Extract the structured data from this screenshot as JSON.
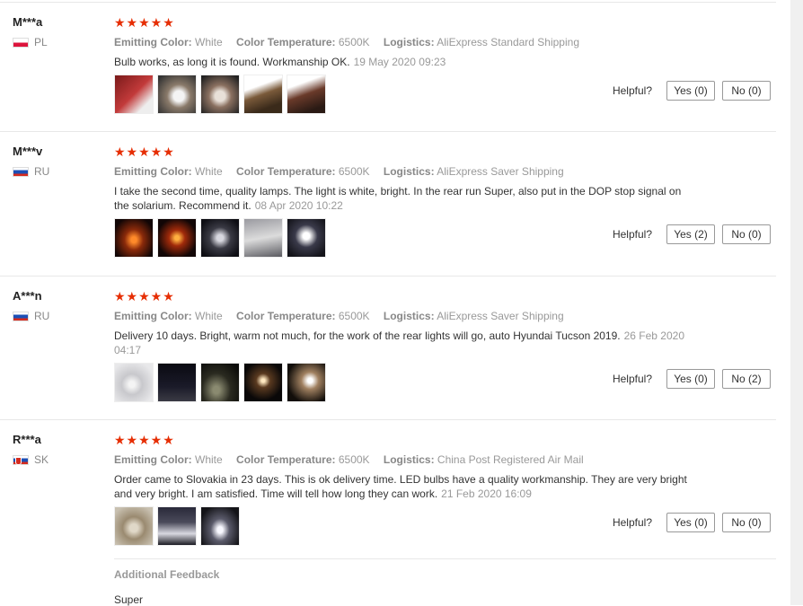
{
  "labels": {
    "emitting_color": "Emitting Color:",
    "color_temperature": "Color Temperature:",
    "logistics": "Logistics:",
    "helpful": "Helpful?"
  },
  "reviews": [
    {
      "name": "M***a",
      "country": "PL",
      "stars": "★★★★★",
      "emitting_color": "White",
      "color_temperature": "6500K",
      "logistics": "AliExpress Standard Shipping",
      "text": "Bulb works, as long it is found. Workmanship OK.",
      "date": "19 May 2020 09:23",
      "yes": "Yes (0)",
      "no": "No (0)"
    },
    {
      "name": "M***v",
      "country": "RU",
      "stars": "★★★★★",
      "emitting_color": "White",
      "color_temperature": "6500K",
      "logistics": "AliExpress Saver Shipping",
      "text": "I take the second time, quality lamps. The light is white, bright. In the rear run Super, also put in the DOP stop signal on the solarium. Recommend it.",
      "date": "08 Apr 2020 10:22",
      "yes": "Yes (2)",
      "no": "No (0)"
    },
    {
      "name": "A***n",
      "country": "RU",
      "stars": "★★★★★",
      "emitting_color": "White",
      "color_temperature": "6500K",
      "logistics": "AliExpress Saver Shipping",
      "text": "Delivery 10 days. Bright, warm not much, for the work of the rear lights will go, auto Hyundai Tucson 2019.",
      "date": "26 Feb 2020 04:17",
      "yes": "Yes (0)",
      "no": "No (2)"
    },
    {
      "name": "R***a",
      "country": "SK",
      "stars": "★★★★★",
      "emitting_color": "White",
      "color_temperature": "6500K",
      "logistics": "China Post Registered Air Mail",
      "text": "Order came to Slovakia in 23 days. This is ok delivery time. LED bulbs have a quality workmanship. They are very bright and very bright. I am satisfied. Time will tell how long they can work.",
      "date": "21 Feb 2020 16:09",
      "yes": "Yes (0)",
      "no": "No (0)"
    }
  ],
  "additional_feedback": {
    "title": "Additional Feedback",
    "text": "Super"
  }
}
